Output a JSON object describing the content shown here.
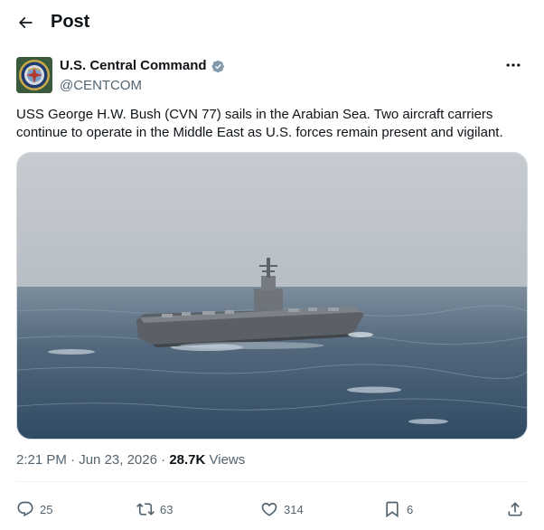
{
  "header": {
    "title": "Post",
    "back_icon": "arrow-left-icon"
  },
  "author": {
    "name": "U.S. Central Command",
    "handle": "@CENTCOM",
    "verified": true,
    "verified_color": "#829aab",
    "avatar_icon": "centcom-seal-icon"
  },
  "post": {
    "text": "USS George H.W. Bush (CVN 77) sails in the Arabian Sea. Two aircraft carriers continue to operate in the Middle East as U.S. forces remain present and vigilant.",
    "media_icon": "aircraft-carrier-photo"
  },
  "meta": {
    "time": "2:21 PM",
    "sep1": " · ",
    "date": "Jun 23, 2026",
    "sep2": " · ",
    "views_count": "28.7K",
    "views_label": " Views"
  },
  "actions": {
    "replies": "25",
    "reposts": "63",
    "likes": "314",
    "bookmarks": "6"
  },
  "colors": {
    "text_primary": "#0f1419",
    "text_secondary": "#536471",
    "border": "#cfd9de"
  }
}
